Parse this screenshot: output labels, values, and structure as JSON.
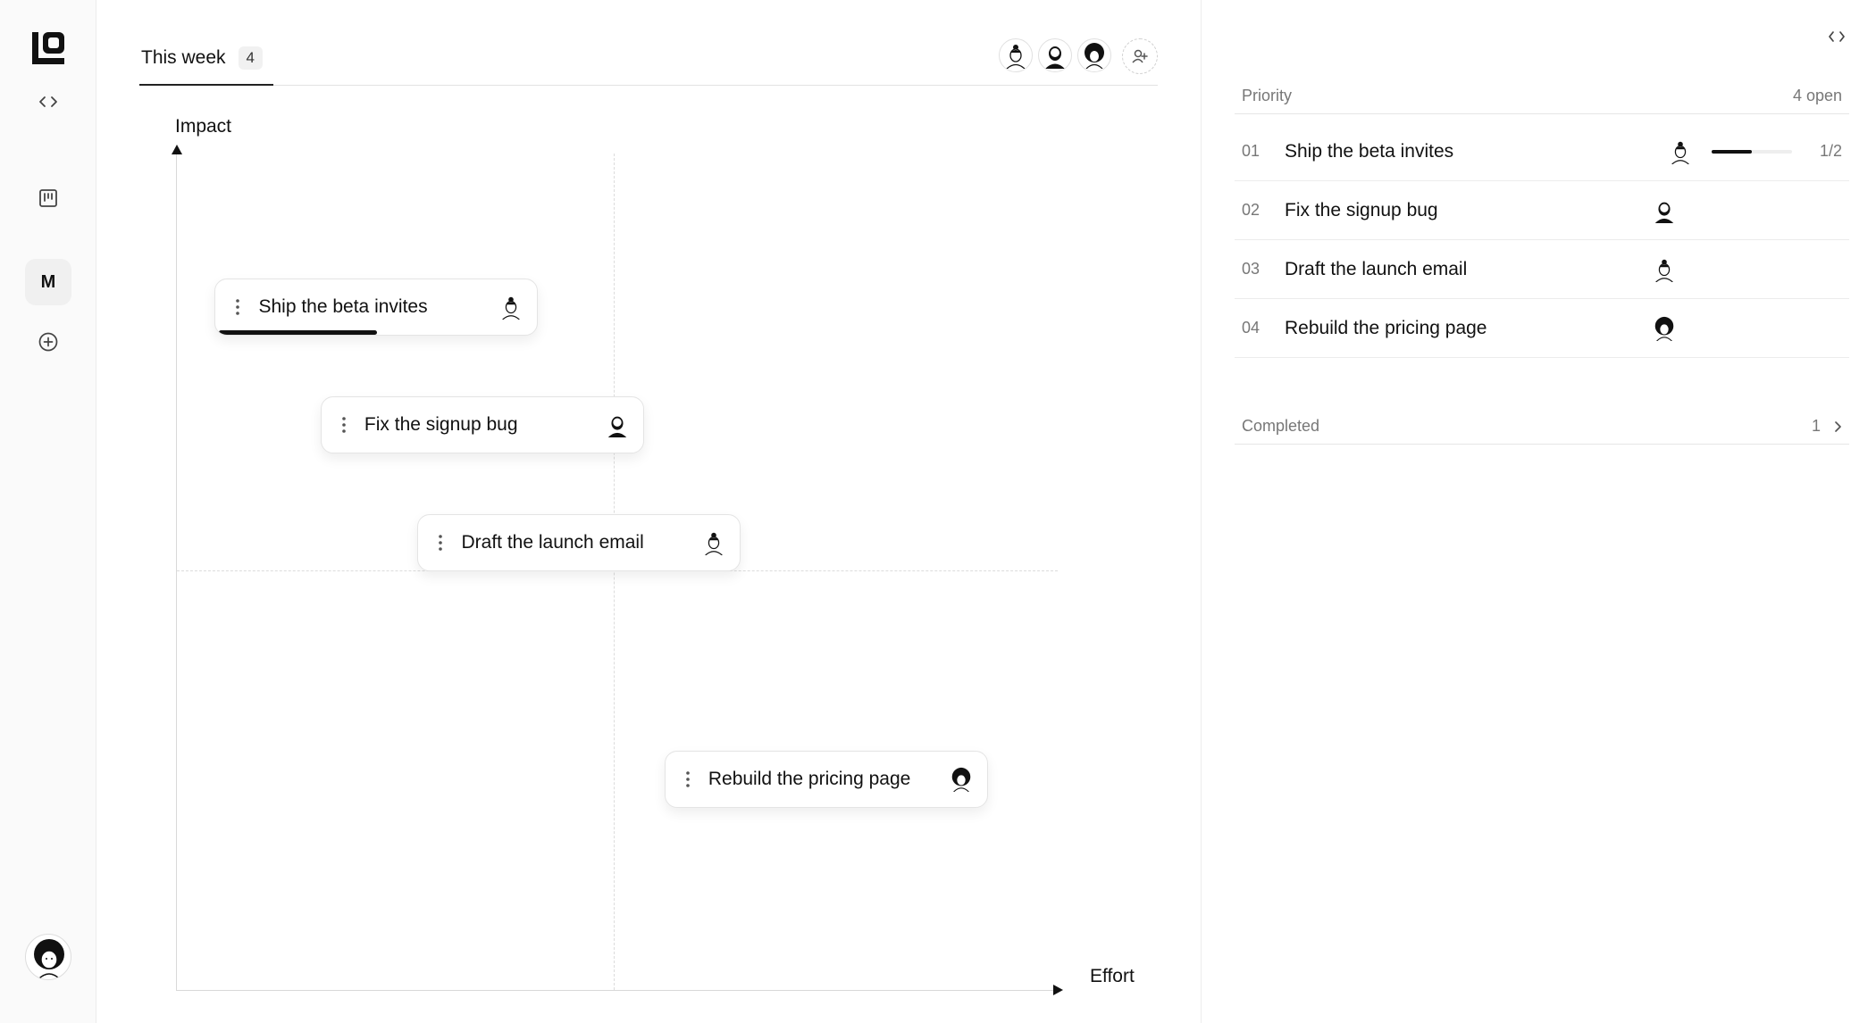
{
  "rail": {
    "logo_icon": "logo-mark",
    "items": [
      {
        "name": "code-toggle",
        "icon": "code-brackets-icon"
      },
      {
        "name": "board-view",
        "icon": "kanban-icon"
      },
      {
        "name": "workspace",
        "label": "M"
      },
      {
        "name": "add-workspace",
        "icon": "plus-circle-icon"
      }
    ],
    "user_avatar": "avatar-afro"
  },
  "board": {
    "tab_title": "This week",
    "tab_count": "4",
    "members": [
      "avatar-bun",
      "avatar-beard",
      "avatar-afro"
    ],
    "y_axis_label": "Impact",
    "x_axis_label": "Effort",
    "effort_axis": [
      0,
      1
    ],
    "impact_axis": [
      0,
      1
    ],
    "cards": [
      {
        "title": "Ship the beta invites",
        "effort": 0.04,
        "impact": 0.81,
        "avatar": "avatar-bun",
        "progress": 0.5
      },
      {
        "title": "Fix the signup bug",
        "effort": 0.16,
        "impact": 0.67,
        "avatar": "avatar-beard"
      },
      {
        "title": "Draft the launch email",
        "effort": 0.27,
        "impact": 0.53,
        "avatar": "avatar-bun"
      },
      {
        "title": "Rebuild the pricing page",
        "effort": 0.55,
        "impact": 0.25,
        "avatar": "avatar-afro"
      }
    ]
  },
  "panel": {
    "priority_label": "Priority",
    "open_label": "4 open",
    "rows": [
      {
        "num": "01",
        "title": "Ship the beta invites",
        "avatar": "avatar-bun",
        "progress": 0.5,
        "fraction": "1/2"
      },
      {
        "num": "02",
        "title": "Fix the signup bug",
        "avatar": "avatar-beard"
      },
      {
        "num": "03",
        "title": "Draft the launch email",
        "avatar": "avatar-bun"
      },
      {
        "num": "04",
        "title": "Rebuild the pricing page",
        "avatar": "avatar-afro"
      }
    ],
    "completed_label": "Completed",
    "completed_count": "1"
  }
}
